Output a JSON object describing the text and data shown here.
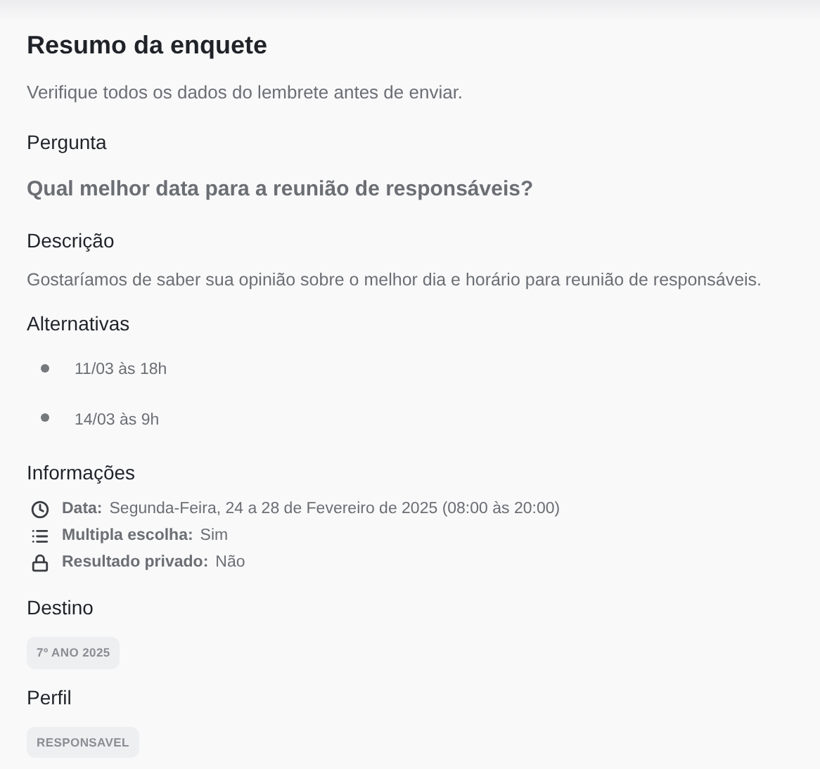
{
  "title": "Resumo da enquete",
  "subtitle": "Verifique todos os dados do lembrete antes de enviar.",
  "question": {
    "label": "Pergunta",
    "text": "Qual melhor data para a reunião de responsáveis?"
  },
  "description": {
    "label": "Descrição",
    "text": "Gostaríamos de saber sua opinião sobre o melhor dia e horário para reunião de responsáveis."
  },
  "alternatives": {
    "label": "Alternativas",
    "items": [
      "11/03 às 18h",
      "14/03 às 9h"
    ]
  },
  "info": {
    "label": "Informações",
    "items": [
      {
        "kind": "clock",
        "label": "Data:",
        "value": "Segunda-Feira, 24 a 28 de Fevereiro de 2025 (08:00 às 20:00)"
      },
      {
        "kind": "list",
        "label": "Multipla escolha:",
        "value": "Sim"
      },
      {
        "kind": "lock",
        "label": "Resultado privado:",
        "value": "Não"
      }
    ]
  },
  "destination": {
    "label": "Destino",
    "tags": [
      "7º ANO 2025"
    ]
  },
  "profile": {
    "label": "Perfil",
    "tags": [
      "RESPONSAVEL"
    ]
  }
}
